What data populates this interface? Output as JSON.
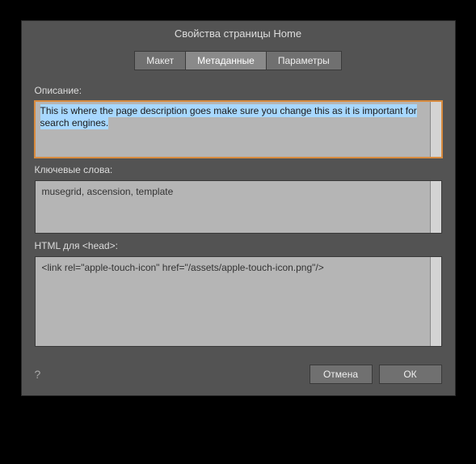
{
  "dialog": {
    "title": "Свойства страницы Home"
  },
  "tabs": {
    "layout": "Макет",
    "metadata": "Метаданные",
    "params": "Параметры"
  },
  "fields": {
    "description": {
      "label": "Описание:",
      "value": "This is where the page description goes make sure you change this as it is important for search engines."
    },
    "keywords": {
      "label": "Ключевые слова:",
      "value": "musegrid, ascension, template"
    },
    "headhtml": {
      "label": "HTML для <head>:",
      "value": "<link rel=\"apple-touch-icon\" href=\"/assets/apple-touch-icon.png\"/>"
    }
  },
  "buttons": {
    "cancel": "Отмена",
    "ok": "ОК"
  },
  "help_icon": "?"
}
